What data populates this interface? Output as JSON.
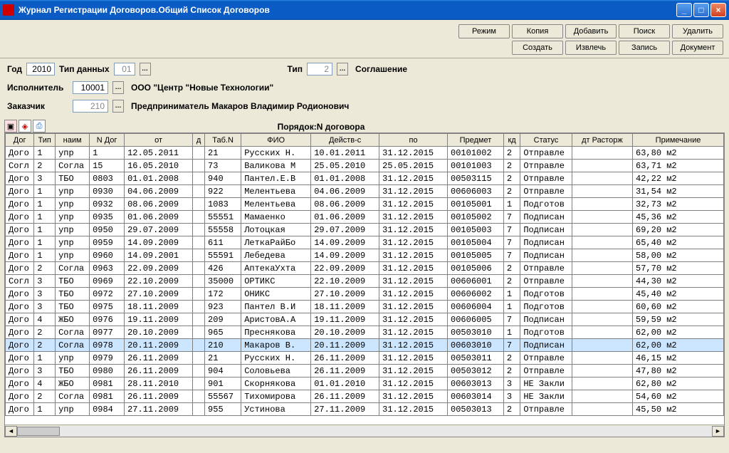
{
  "window": {
    "title": "Журнал Регистрации Договоров.Общий Список Договоров"
  },
  "toolbar": {
    "row1": [
      "Режим",
      "Копия",
      "Добавить",
      "Поиск",
      "Удалить"
    ],
    "row2": [
      "Создать",
      "Извлечь",
      "Запись",
      "Документ"
    ]
  },
  "filters": {
    "year_label": "Год",
    "year_value": "2010",
    "data_type_label": "Тип данных",
    "data_type_value": "01",
    "tip_label": "Тип",
    "tip_value": "2",
    "tip_text": "Соглашение",
    "executor_label": "Исполнитель",
    "executor_value": "10001",
    "executor_text": "ООО \"Центр \"Новые Технологии\"",
    "customer_label": "Заказчик",
    "customer_value": "210",
    "customer_text": "Предприниматель Макаров Владимир Родионович"
  },
  "order_label": "Порядок:N договора",
  "columns": [
    "Дог",
    "Тип",
    "наим",
    "N Дог",
    "от",
    "д",
    "Таб.N",
    "ФИО",
    "Действ-с",
    "по",
    "Предмет",
    "кд",
    "Статус",
    "дт Расторж",
    "Примечание"
  ],
  "rows": [
    {
      "dog": "Дого",
      "tip": "1",
      "naim": "упр",
      "ndog": "1",
      "ot": "12.05.2011",
      "d": "",
      "tabn": "21",
      "fio": "Русских Н.",
      "deist": "10.01.2011",
      "po": "31.12.2015",
      "pred": "00101002",
      "kd": "2",
      "stat": "Отправле",
      "rast": "",
      "prim": "63,80 м2"
    },
    {
      "dog": "Согл",
      "tip": "2",
      "naim": "Согла",
      "ndog": "15",
      "ot": "16.05.2010",
      "d": "",
      "tabn": "73",
      "fio": "Валикова М",
      "deist": "25.05.2010",
      "po": "25.05.2015",
      "pred": "00101003",
      "kd": "2",
      "stat": "Отправле",
      "rast": "",
      "prim": "63,71 м2"
    },
    {
      "dog": "Дого",
      "tip": "3",
      "naim": "ТБО",
      "ndog": "0803",
      "ot": "01.01.2008",
      "d": "",
      "tabn": "940",
      "fio": "Пантел.Е.В",
      "deist": "01.01.2008",
      "po": "31.12.2015",
      "pred": "00503115",
      "kd": "2",
      "stat": "Отправле",
      "rast": "",
      "prim": "42,22 м2"
    },
    {
      "dog": "Дого",
      "tip": "1",
      "naim": "упр",
      "ndog": "0930",
      "ot": "04.06.2009",
      "d": "",
      "tabn": "922",
      "fio": "Мелентьева",
      "deist": "04.06.2009",
      "po": "31.12.2015",
      "pred": "00606003",
      "kd": "2",
      "stat": "Отправле",
      "rast": "",
      "prim": "31,54 м2"
    },
    {
      "dog": "Дого",
      "tip": "1",
      "naim": "упр",
      "ndog": "0932",
      "ot": "08.06.2009",
      "d": "",
      "tabn": "1083",
      "fio": "Мелентьева",
      "deist": "08.06.2009",
      "po": "31.12.2015",
      "pred": "00105001",
      "kd": "1",
      "stat": "Подготов",
      "rast": "",
      "prim": "32,73 м2"
    },
    {
      "dog": "Дого",
      "tip": "1",
      "naim": "упр",
      "ndog": "0935",
      "ot": "01.06.2009",
      "d": "",
      "tabn": "55551",
      "fio": "Мамаенко",
      "deist": "01.06.2009",
      "po": "31.12.2015",
      "pred": "00105002",
      "kd": "7",
      "stat": "Подписан",
      "rast": "",
      "prim": "45,36 м2"
    },
    {
      "dog": "Дого",
      "tip": "1",
      "naim": "упр",
      "ndog": "0950",
      "ot": "29.07.2009",
      "d": "",
      "tabn": "55558",
      "fio": "Лотоцкая",
      "deist": "29.07.2009",
      "po": "31.12.2015",
      "pred": "00105003",
      "kd": "7",
      "stat": "Подписан",
      "rast": "",
      "prim": "69,20 м2"
    },
    {
      "dog": "Дого",
      "tip": "1",
      "naim": "упр",
      "ndog": "0959",
      "ot": "14.09.2009",
      "d": "",
      "tabn": "611",
      "fio": "ЛеткаРайБо",
      "deist": "14.09.2009",
      "po": "31.12.2015",
      "pred": "00105004",
      "kd": "7",
      "stat": "Подписан",
      "rast": "",
      "prim": "65,40 м2"
    },
    {
      "dog": "Дого",
      "tip": "1",
      "naim": "упр",
      "ndog": "0960",
      "ot": "14.09.2001",
      "d": "",
      "tabn": "55591",
      "fio": "Лебедева",
      "deist": "14.09.2009",
      "po": "31.12.2015",
      "pred": "00105005",
      "kd": "7",
      "stat": "Подписан",
      "rast": "",
      "prim": "58,00 м2"
    },
    {
      "dog": "Дого",
      "tip": "2",
      "naim": "Согла",
      "ndog": "0963",
      "ot": "22.09.2009",
      "d": "",
      "tabn": "426",
      "fio": "АптекаУхта",
      "deist": "22.09.2009",
      "po": "31.12.2015",
      "pred": "00105006",
      "kd": "2",
      "stat": "Отправле",
      "rast": "",
      "prim": "57,70 м2"
    },
    {
      "dog": "Согл",
      "tip": "3",
      "naim": "ТБО",
      "ndog": "0969",
      "ot": "22.10.2009",
      "d": "",
      "tabn": "35000",
      "fio": "ОРТИКС",
      "deist": "22.10.2009",
      "po": "31.12.2015",
      "pred": "00606001",
      "kd": "2",
      "stat": "Отправле",
      "rast": "",
      "prim": "44,30 м2"
    },
    {
      "dog": "Дого",
      "tip": "3",
      "naim": "ТБО",
      "ndog": "0972",
      "ot": "27.10.2009",
      "d": "",
      "tabn": "172",
      "fio": "ОНИКС",
      "deist": "27.10.2009",
      "po": "31.12.2015",
      "pred": "00606002",
      "kd": "1",
      "stat": "Подготов",
      "rast": "",
      "prim": "45,40 м2"
    },
    {
      "dog": "Дого",
      "tip": "3",
      "naim": "ТБО",
      "ndog": "0975",
      "ot": "18.11.2009",
      "d": "",
      "tabn": "923",
      "fio": "Пантел В.И",
      "deist": "18.11.2009",
      "po": "31.12.2015",
      "pred": "00606004",
      "kd": "1",
      "stat": "Подготов",
      "rast": "",
      "prim": "60,60 м2"
    },
    {
      "dog": "Дого",
      "tip": "4",
      "naim": "ЖБО",
      "ndog": "0976",
      "ot": "19.11.2009",
      "d": "",
      "tabn": "209",
      "fio": "АристовА.А",
      "deist": "19.11.2009",
      "po": "31.12.2015",
      "pred": "00606005",
      "kd": "7",
      "stat": "Подписан",
      "rast": "",
      "prim": "59,59 м2"
    },
    {
      "dog": "Дого",
      "tip": "2",
      "naim": "Согла",
      "ndog": "0977",
      "ot": "20.10.2009",
      "d": "",
      "tabn": "965",
      "fio": "Преснякова",
      "deist": "20.10.2009",
      "po": "31.12.2015",
      "pred": "00503010",
      "kd": "1",
      "stat": "Подготов",
      "rast": "",
      "prim": "62,00 м2"
    },
    {
      "dog": "Дого",
      "tip": "2",
      "naim": "Согла",
      "ndog": "0978",
      "ot": "20.11.2009",
      "d": "",
      "tabn": "210",
      "fio": "Макаров В.",
      "deist": "20.11.2009",
      "po": "31.12.2015",
      "pred": "00603010",
      "kd": "7",
      "stat": "Подписан",
      "rast": "",
      "prim": "62,00 м2",
      "selected": true
    },
    {
      "dog": "Дого",
      "tip": "1",
      "naim": "упр",
      "ndog": "0979",
      "ot": "26.11.2009",
      "d": "",
      "tabn": "21",
      "fio": "Русских Н.",
      "deist": "26.11.2009",
      "po": "31.12.2015",
      "pred": "00503011",
      "kd": "2",
      "stat": "Отправле",
      "rast": "",
      "prim": "46,15 м2"
    },
    {
      "dog": "Дого",
      "tip": "3",
      "naim": "ТБО",
      "ndog": "0980",
      "ot": "26.11.2009",
      "d": "",
      "tabn": "904",
      "fio": "Соловьева",
      "deist": "26.11.2009",
      "po": "31.12.2015",
      "pred": "00503012",
      "kd": "2",
      "stat": "Отправле",
      "rast": "",
      "prim": "47,80 м2"
    },
    {
      "dog": "Дого",
      "tip": "4",
      "naim": "ЖБО",
      "ndog": "0981",
      "ot": "28.11.2010",
      "d": "",
      "tabn": "901",
      "fio": "Скорнякова",
      "deist": "01.01.2010",
      "po": "31.12.2015",
      "pred": "00603013",
      "kd": "3",
      "stat": "НЕ Закли",
      "rast": "",
      "prim": "62,80 м2"
    },
    {
      "dog": "Дого",
      "tip": "2",
      "naim": "Согла",
      "ndog": "0981",
      "ot": "26.11.2009",
      "d": "",
      "tabn": "55567",
      "fio": "Тихомирова",
      "deist": "26.11.2009",
      "po": "31.12.2015",
      "pred": "00603014",
      "kd": "3",
      "stat": "НЕ Закли",
      "rast": "",
      "prim": "54,60 м2"
    },
    {
      "dog": "Дого",
      "tip": "1",
      "naim": "упр",
      "ndog": "0984",
      "ot": "27.11.2009",
      "d": "",
      "tabn": "955",
      "fio": "Устинова",
      "deist": "27.11.2009",
      "po": "31.12.2015",
      "pred": "00503013",
      "kd": "2",
      "stat": "Отправле",
      "rast": "",
      "prim": "45,50 м2"
    }
  ]
}
